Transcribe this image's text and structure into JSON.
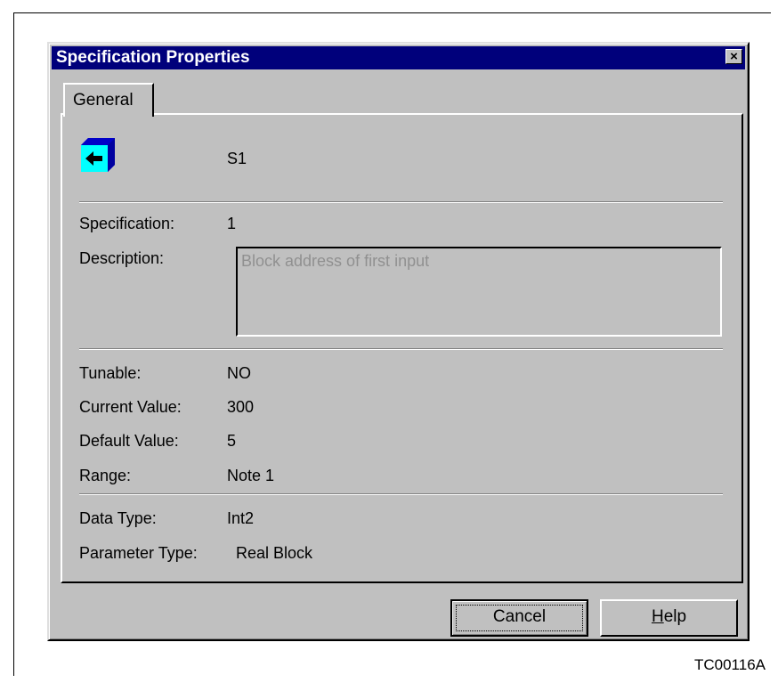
{
  "dialog": {
    "title": "Specification Properties",
    "close_symbol": "×"
  },
  "tab": {
    "label": "General"
  },
  "header": {
    "icon": "input-block-icon",
    "name": "S1"
  },
  "fields": {
    "specification_label": "Specification:",
    "specification_value": "1",
    "description_label": "Description:",
    "description_value": "Block address of first input",
    "tunable_label": "Tunable:",
    "tunable_value": "NO",
    "current_label": "Current Value:",
    "current_value": "300",
    "default_label": "Default Value:",
    "default_value": "5",
    "range_label": "Range:",
    "range_value": "Note 1",
    "datatype_label": "Data Type:",
    "datatype_value": "Int2",
    "paramtype_label": "Parameter Type:",
    "paramtype_value": "Real Block"
  },
  "buttons": {
    "cancel": "Cancel",
    "help_mnemonic": "H",
    "help_rest": "elp"
  },
  "caption": "TC00116A",
  "colors": {
    "title_bar": "#00007b",
    "face": "#c0c0c0",
    "icon_cyan": "#00ffff",
    "icon_blue": "#0000ff"
  }
}
